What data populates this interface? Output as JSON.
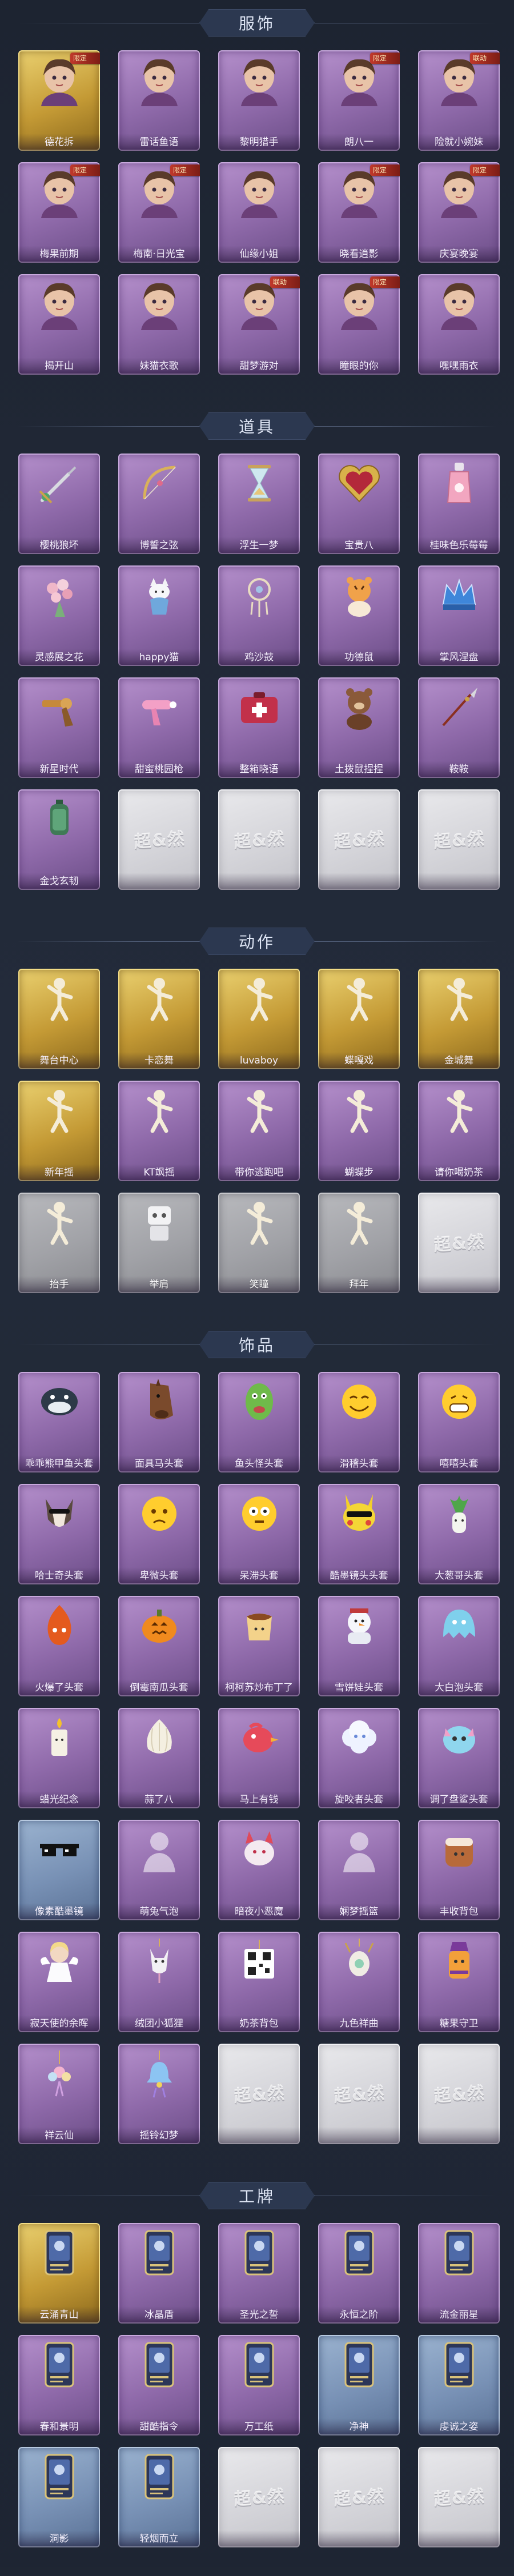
{
  "colors": {
    "page_bg": "#1f2633",
    "purple": "#8e69a9",
    "gold": "#c49a35",
    "blue": "#7891b5",
    "gray": "#a1a2a7"
  },
  "sections": [
    {
      "title": "服饰",
      "items": [
        {
          "name": "德花拆",
          "rarity": "gold",
          "icon": "character-icon",
          "badge": "限定"
        },
        {
          "name": "雷话鱼语",
          "rarity": "purple",
          "icon": "character-icon"
        },
        {
          "name": "黎明猎手",
          "rarity": "purple",
          "icon": "character-icon"
        },
        {
          "name": "朗八一",
          "rarity": "purple",
          "icon": "character-icon",
          "badge": "限定"
        },
        {
          "name": "险就小婉妹",
          "rarity": "purple",
          "icon": "character-icon",
          "badge": "联动"
        },
        {
          "name": "梅果前期",
          "rarity": "purple",
          "icon": "character-icon",
          "badge": "限定"
        },
        {
          "name": "梅南·日光宝",
          "rarity": "purple",
          "icon": "character-icon",
          "badge": "限定"
        },
        {
          "name": "仙缘小姐",
          "rarity": "purple",
          "icon": "character-icon"
        },
        {
          "name": "晓看逍影",
          "rarity": "purple",
          "icon": "character-icon",
          "badge": "限定"
        },
        {
          "name": "庆宴晚宴",
          "rarity": "purple",
          "icon": "character-icon",
          "badge": "限定"
        },
        {
          "name": "揭开山",
          "rarity": "purple",
          "icon": "character-icon"
        },
        {
          "name": "妹猫衣歌",
          "rarity": "purple",
          "icon": "character-icon"
        },
        {
          "name": "甜梦游对",
          "rarity": "purple",
          "icon": "character-icon",
          "badge": "联动"
        },
        {
          "name": "瞳眼的你",
          "rarity": "purple",
          "icon": "character-icon",
          "badge": "限定"
        },
        {
          "name": "嘿嘿雨衣",
          "rarity": "purple",
          "icon": "character-icon"
        }
      ]
    },
    {
      "title": "道具",
      "items": [
        {
          "name": "樱桃狼坏",
          "rarity": "purple",
          "icon": "sword-icon"
        },
        {
          "name": "博誓之弦",
          "rarity": "purple",
          "icon": "bow-icon"
        },
        {
          "name": "浮生一梦",
          "rarity": "purple",
          "icon": "hourglass-icon"
        },
        {
          "name": "宝贵八",
          "rarity": "purple",
          "icon": "heart-frame-icon"
        },
        {
          "name": "桂味色乐莓莓",
          "rarity": "purple",
          "icon": "bottle-icon"
        },
        {
          "name": "灵感展之花",
          "rarity": "purple",
          "icon": "bouquet-icon"
        },
        {
          "name": "happy猫",
          "rarity": "purple",
          "icon": "cat-vase-icon"
        },
        {
          "name": "鸡沙鼓",
          "rarity": "purple",
          "icon": "dreamcatcher-icon"
        },
        {
          "name": "功德鼠",
          "rarity": "purple",
          "icon": "tiger-doll-icon"
        },
        {
          "name": "掌风涅盘",
          "rarity": "purple",
          "icon": "blue-crown-icon"
        },
        {
          "name": "新星时代",
          "rarity": "purple",
          "icon": "revolver-icon"
        },
        {
          "name": "甜蜜桃园枪",
          "rarity": "purple",
          "icon": "pink-gun-icon"
        },
        {
          "name": "整箱晓语",
          "rarity": "purple",
          "icon": "medkit-icon"
        },
        {
          "name": "土拨鼠捏捏",
          "rarity": "purple",
          "icon": "bear-doll-icon"
        },
        {
          "name": "鞍鞍",
          "rarity": "purple",
          "icon": "spear-icon"
        },
        {
          "name": "金戈玄韧",
          "rarity": "purple",
          "icon": "lantern-icon"
        },
        {
          "name": "",
          "rarity": "white",
          "icon": "placeholder",
          "placeholder": "超&然"
        },
        {
          "name": "",
          "rarity": "white",
          "icon": "placeholder",
          "placeholder": "超&然"
        },
        {
          "name": "",
          "rarity": "white",
          "icon": "placeholder",
          "placeholder": "超&然"
        },
        {
          "name": "",
          "rarity": "white",
          "icon": "placeholder",
          "placeholder": "超&然"
        }
      ]
    },
    {
      "title": "动作",
      "items": [
        {
          "name": "舞台中心",
          "rarity": "gold",
          "icon": "pose-icon"
        },
        {
          "name": "卡恋舞",
          "rarity": "gold",
          "icon": "pose-icon"
        },
        {
          "name": "luvaboy",
          "rarity": "gold",
          "icon": "pose-icon"
        },
        {
          "name": "蝶嘎戏",
          "rarity": "gold",
          "icon": "pose-icon"
        },
        {
          "name": "金城舞",
          "rarity": "gold",
          "icon": "pose-icon"
        },
        {
          "name": "新年摇",
          "rarity": "gold",
          "icon": "pose-icon"
        },
        {
          "name": "KT飒摇",
          "rarity": "purple",
          "icon": "pose-icon"
        },
        {
          "name": "带你逃跑吧",
          "rarity": "purple",
          "icon": "pose-icon"
        },
        {
          "name": "蝴蝶步",
          "rarity": "purple",
          "icon": "pose-icon"
        },
        {
          "name": "请你喝奶茶",
          "rarity": "purple",
          "icon": "pose-icon"
        },
        {
          "name": "抬手",
          "rarity": "gray",
          "icon": "pose-icon"
        },
        {
          "name": "举肩",
          "rarity": "gray",
          "icon": "robot-icon"
        },
        {
          "name": "笑瞳",
          "rarity": "gray",
          "icon": "pose-icon"
        },
        {
          "name": "拜年",
          "rarity": "gray",
          "icon": "pose-icon"
        },
        {
          "name": "",
          "rarity": "white",
          "icon": "placeholder",
          "placeholder": "超&然"
        }
      ]
    },
    {
      "title": "饰品",
      "items": [
        {
          "name": "乖乖熊甲鱼头套",
          "rarity": "purple",
          "icon": "fish-head-icon"
        },
        {
          "name": "面具马头套",
          "rarity": "purple",
          "icon": "horse-head-icon"
        },
        {
          "name": "鱼头怪头套",
          "rarity": "purple",
          "icon": "green-fish-icon"
        },
        {
          "name": "滑稽头套",
          "rarity": "purple",
          "icon": "smiley-icon"
        },
        {
          "name": "嘻嘻头套",
          "rarity": "purple",
          "icon": "grin-icon"
        },
        {
          "name": "哈士奇头套",
          "rarity": "purple",
          "icon": "husky-head-icon"
        },
        {
          "name": "卑微头套",
          "rarity": "purple",
          "icon": "sad-face-icon"
        },
        {
          "name": "呆滞头套",
          "rarity": "purple",
          "icon": "dazed-face-icon"
        },
        {
          "name": "酷墨镜头头套",
          "rarity": "purple",
          "icon": "pikachu-glasses-icon"
        },
        {
          "name": "大葱哥头套",
          "rarity": "purple",
          "icon": "leek-icon"
        },
        {
          "name": "火爆了头套",
          "rarity": "purple",
          "icon": "flame-face-icon"
        },
        {
          "name": "倒霉南瓜头套",
          "rarity": "purple",
          "icon": "pumpkin-icon"
        },
        {
          "name": "柯柯苏炒布丁了",
          "rarity": "purple",
          "icon": "pudding-icon"
        },
        {
          "name": "雪饼娃头套",
          "rarity": "purple",
          "icon": "snowman-icon"
        },
        {
          "name": "大白泡头套",
          "rarity": "purple",
          "icon": "ghost-blob-icon"
        },
        {
          "name": "蜡光纪念",
          "rarity": "purple",
          "icon": "candle-icon"
        },
        {
          "name": "蒜了八",
          "rarity": "purple",
          "icon": "garlic-icon"
        },
        {
          "name": "马上有钱",
          "rarity": "purple",
          "icon": "red-bird-icon"
        },
        {
          "name": "旋咬者头套",
          "rarity": "purple",
          "icon": "cloud-creature-icon"
        },
        {
          "name": "调了盘鲨头套",
          "rarity": "purple",
          "icon": "cute-creature-icon"
        },
        {
          "name": "像素酷墨镜",
          "rarity": "blue",
          "icon": "pixel-sunglasses-icon"
        },
        {
          "name": "萌兔气泡",
          "rarity": "purple",
          "icon": "silhouette-icon"
        },
        {
          "name": "暗夜小恶魔",
          "rarity": "purple",
          "icon": "devil-icon"
        },
        {
          "name": "娴梦摇篮",
          "rarity": "purple",
          "icon": "silhouette-icon"
        },
        {
          "name": "丰收背包",
          "rarity": "purple",
          "icon": "cake-backpack-icon"
        },
        {
          "name": "寂天使的余晖",
          "rarity": "purple",
          "icon": "angel-doll-icon"
        },
        {
          "name": "绒团小狐狸",
          "rarity": "purple",
          "icon": "fox-charm-icon"
        },
        {
          "name": "奶茶背包",
          "rarity": "purple",
          "icon": "qr-tag-icon"
        },
        {
          "name": "九色祥曲",
          "rarity": "purple",
          "icon": "deer-charm-icon"
        },
        {
          "name": "糖果守卫",
          "rarity": "purple",
          "icon": "candy-guard-icon"
        },
        {
          "name": "祥云仙",
          "rarity": "purple",
          "icon": "flower-charm-icon"
        },
        {
          "name": "摇铃幻梦",
          "rarity": "purple",
          "icon": "bell-charm-icon"
        },
        {
          "name": "",
          "rarity": "white",
          "icon": "placeholder",
          "placeholder": "超&然"
        },
        {
          "name": "",
          "rarity": "white",
          "icon": "placeholder",
          "placeholder": "超&然"
        },
        {
          "name": "",
          "rarity": "white",
          "icon": "placeholder",
          "placeholder": "超&然"
        }
      ]
    },
    {
      "title": "工牌",
      "items": [
        {
          "name": "云涌青山",
          "rarity": "gold",
          "icon": "badge-card-icon"
        },
        {
          "name": "冰晶盾",
          "rarity": "purple",
          "icon": "badge-card-icon"
        },
        {
          "name": "圣光之誓",
          "rarity": "purple",
          "icon": "badge-card-icon"
        },
        {
          "name": "永恒之阶",
          "rarity": "purple",
          "icon": "badge-card-icon"
        },
        {
          "name": "流金丽星",
          "rarity": "purple",
          "icon": "badge-card-icon"
        },
        {
          "name": "春和景明",
          "rarity": "purple",
          "icon": "badge-card-icon"
        },
        {
          "name": "甜酷指令",
          "rarity": "purple",
          "icon": "badge-card-icon"
        },
        {
          "name": "万工纸",
          "rarity": "purple",
          "icon": "badge-card-icon"
        },
        {
          "name": "净神",
          "rarity": "blue",
          "icon": "badge-card-icon"
        },
        {
          "name": "虔诚之姿",
          "rarity": "blue",
          "icon": "badge-card-icon"
        },
        {
          "name": "洞影",
          "rarity": "blue",
          "icon": "badge-card-icon"
        },
        {
          "name": "轻烟而立",
          "rarity": "blue",
          "icon": "badge-card-icon"
        },
        {
          "name": "",
          "rarity": "white",
          "icon": "placeholder",
          "placeholder": "超&然"
        },
        {
          "name": "",
          "rarity": "white",
          "icon": "placeholder",
          "placeholder": "超&然"
        },
        {
          "name": "",
          "rarity": "white",
          "icon": "placeholder",
          "placeholder": "超&然"
        }
      ]
    }
  ]
}
